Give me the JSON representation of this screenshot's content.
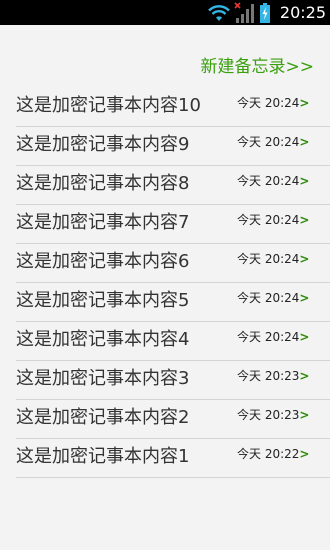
{
  "status_bar": {
    "time": "20:25",
    "icons": [
      "wifi-icon",
      "signal-no-service-icon",
      "battery-charging-icon"
    ]
  },
  "header": {
    "new_memo_label": "新建备忘录>>"
  },
  "memos": [
    {
      "title": "这是加密记事本内容10",
      "time": "今天 20:24",
      "arrow": ">"
    },
    {
      "title": "这是加密记事本内容9",
      "time": "今天 20:24",
      "arrow": ">"
    },
    {
      "title": "这是加密记事本内容8",
      "time": "今天 20:24",
      "arrow": ">"
    },
    {
      "title": "这是加密记事本内容7",
      "time": "今天 20:24",
      "arrow": ">"
    },
    {
      "title": "这是加密记事本内容6",
      "time": "今天 20:24",
      "arrow": ">"
    },
    {
      "title": "这是加密记事本内容5",
      "time": "今天 20:24",
      "arrow": ">"
    },
    {
      "title": "这是加密记事本内容4",
      "time": "今天 20:24",
      "arrow": ">"
    },
    {
      "title": "这是加密记事本内容3",
      "time": "今天 20:23",
      "arrow": ">"
    },
    {
      "title": "这是加密记事本内容2",
      "time": "今天 20:23",
      "arrow": ">"
    },
    {
      "title": "这是加密记事本内容1",
      "time": "今天 20:22",
      "arrow": ">"
    }
  ],
  "colors": {
    "accent_green": "#3aa00e",
    "arrow_green": "#2e8b0a",
    "status_bar_bg": "#000000",
    "battery_blue": "#33b5e5"
  }
}
